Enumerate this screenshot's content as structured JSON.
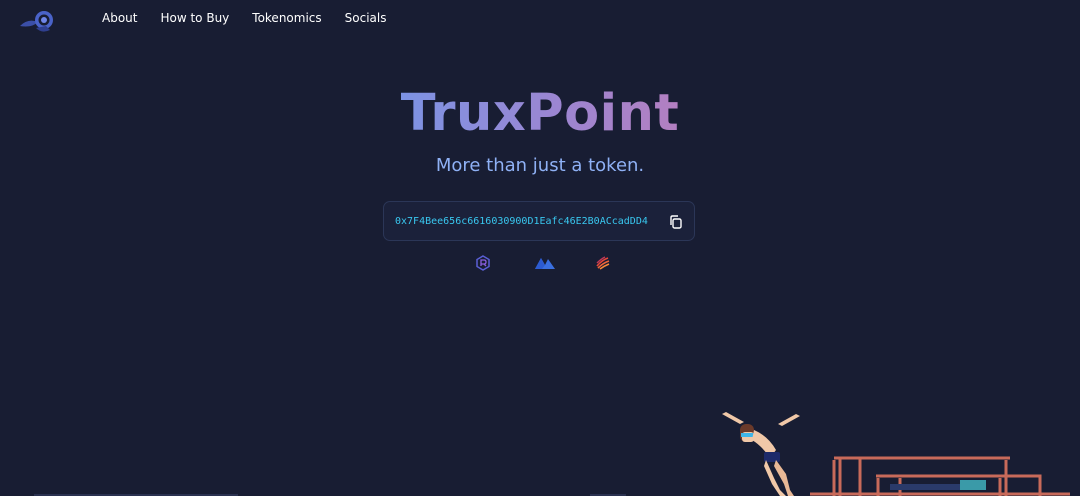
{
  "nav": {
    "logo_name": "truxpoint-logo",
    "links": [
      {
        "label": "About"
      },
      {
        "label": "How to Buy"
      },
      {
        "label": "Tokenomics"
      },
      {
        "label": "Socials"
      }
    ]
  },
  "hero": {
    "title": "TruxPoint",
    "subtitle": "More than just a token."
  },
  "contract": {
    "address": "0x7F4Bee656c6616030900D1Eafc46E2B0ACcadDD4",
    "copy_icon": "copy-icon"
  },
  "partners": [
    {
      "icon": "raydium-icon"
    },
    {
      "icon": "meteora-icon"
    },
    {
      "icon": "jupiter-icon"
    }
  ],
  "colors": {
    "background": "#181d33",
    "title_gradient_start": "#7d93e4",
    "title_gradient_end": "#b37fc1",
    "subtitle": "#8fb1f5",
    "address": "#39c8f0"
  }
}
